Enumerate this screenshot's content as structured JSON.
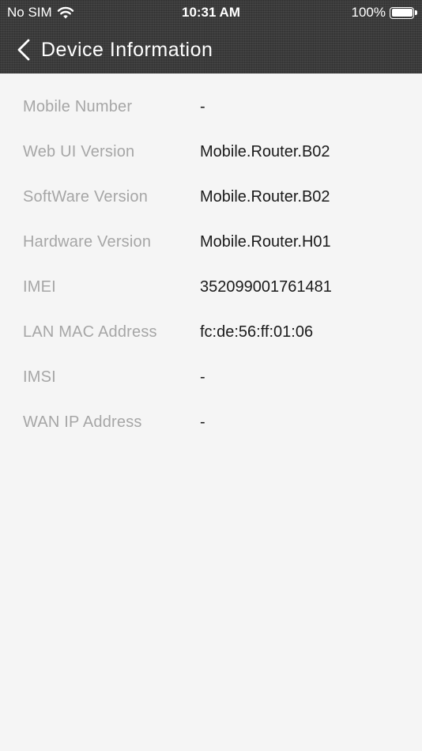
{
  "status_bar": {
    "carrier": "No SIM",
    "time": "10:31 AM",
    "battery": "100%",
    "wifi_icon": "wifi-icon",
    "battery_icon": "battery-icon",
    "battery_level": 1.0
  },
  "nav": {
    "title": "Device Information",
    "back_icon": "chevron-left-icon"
  },
  "colors": {
    "header_bg": "#3b3b3b",
    "page_bg": "#f5f5f5",
    "label": "#a6a6a6",
    "value": "#1a1a1a"
  },
  "info": {
    "rows": [
      {
        "label": "Mobile Number",
        "value": "-"
      },
      {
        "label": "Web UI Version",
        "value": "Mobile.Router.B02"
      },
      {
        "label": "SoftWare Version",
        "value": "Mobile.Router.B02"
      },
      {
        "label": "Hardware Version",
        "value": "Mobile.Router.H01"
      },
      {
        "label": "IMEI",
        "value": "352099001761481"
      },
      {
        "label": "LAN MAC Address",
        "value": "fc:de:56:ff:01:06"
      },
      {
        "label": "IMSI",
        "value": "-"
      },
      {
        "label": "WAN IP Address",
        "value": "-"
      }
    ]
  }
}
